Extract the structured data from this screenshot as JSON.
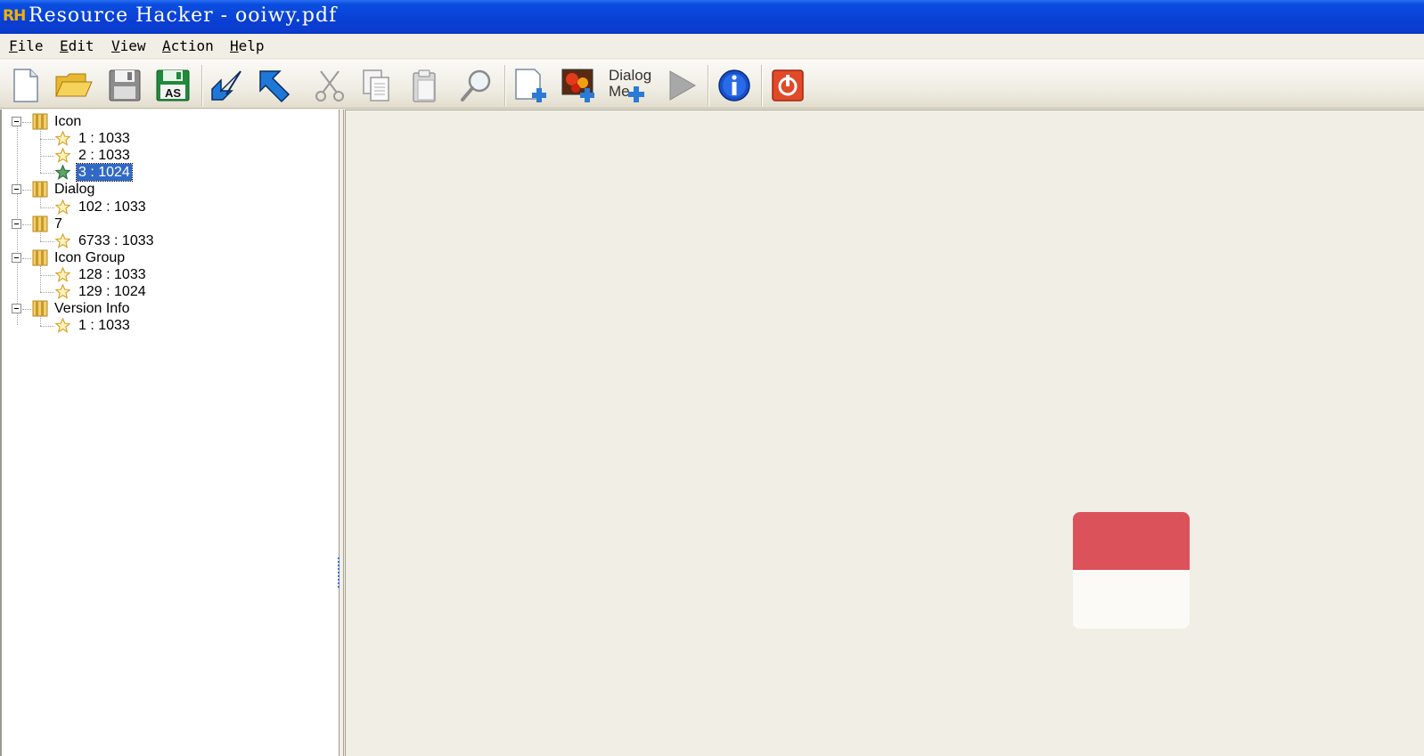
{
  "window": {
    "logo_text": "RH",
    "title": "Resource Hacker - ooiwy.pdf"
  },
  "menu": {
    "items": [
      "File",
      "Edit",
      "View",
      "Action",
      "Help"
    ]
  },
  "toolbar": {
    "buttons": [
      {
        "name": "new-file-icon"
      },
      {
        "name": "open-folder-icon"
      },
      {
        "name": "save-icon"
      },
      {
        "name": "save-as-icon",
        "label": "AS"
      },
      {
        "name": "compile-arrow-icon"
      },
      {
        "name": "jump-arrow-icon"
      },
      {
        "name": "cut-icon"
      },
      {
        "name": "copy-icon"
      },
      {
        "name": "paste-icon"
      },
      {
        "name": "find-icon"
      },
      {
        "name": "add-blank-resource-icon"
      },
      {
        "name": "add-image-resource-icon"
      },
      {
        "name": "dialog-merge-icon",
        "label_line1": "Dialog",
        "label_line2": "Me"
      },
      {
        "name": "play-icon"
      },
      {
        "name": "info-icon"
      },
      {
        "name": "exit-power-icon"
      }
    ]
  },
  "tree": {
    "groups": [
      {
        "label": "Icon",
        "children": [
          {
            "label": "1 : 1033",
            "selected": false
          },
          {
            "label": "2 : 1033",
            "selected": false
          },
          {
            "label": "3 : 1024",
            "selected": true
          }
        ]
      },
      {
        "label": "Dialog",
        "children": [
          {
            "label": "102 : 1033",
            "selected": false
          }
        ]
      },
      {
        "label": "7",
        "children": [
          {
            "label": "6733 : 1033",
            "selected": false
          }
        ]
      },
      {
        "label": "Icon Group",
        "children": [
          {
            "label": "128 : 1033",
            "selected": false
          },
          {
            "label": "129 : 1024",
            "selected": false
          }
        ]
      },
      {
        "label": "Version Info",
        "children": [
          {
            "label": "1 : 1033",
            "selected": false
          }
        ]
      }
    ]
  },
  "preview": {
    "top_color": "#dc525a",
    "bottom_color": "#fbfaf6"
  },
  "colors": {
    "titlebar": "#0a3fd4",
    "selection": "#3169c6"
  }
}
